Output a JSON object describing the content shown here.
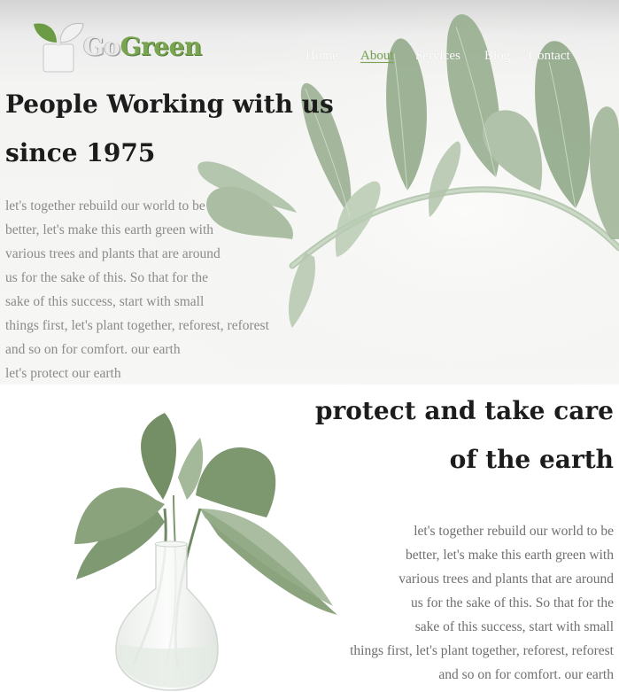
{
  "brand": {
    "name_part1": "Go",
    "name_part2": "Green",
    "accent_color": "#79a551"
  },
  "nav": {
    "items": [
      {
        "label": "Home"
      },
      {
        "label": "About",
        "active": true
      },
      {
        "label": "Services"
      },
      {
        "label": "Blog"
      },
      {
        "label": "Contact"
      }
    ]
  },
  "hero": {
    "title_line1": "People Working with us",
    "title_line2": "since 1975",
    "paragraph_lines": [
      "let's together rebuild our world to be",
      "better, let's make this earth green with",
      "various trees and plants that are around",
      "us for the sake of this. So that for the",
      "sake of this success, start with small",
      "things first, let's plant together, reforest, reforest",
      "and so on for comfort. our earth",
      "let's protect our earth"
    ]
  },
  "section2": {
    "title_line1": "protect and take care",
    "title_line2": "of the earth",
    "paragraph_lines": [
      "let's together rebuild our world to be",
      "better, let's make this earth green with",
      "various trees and plants that are around",
      "us for the sake of this. So that for the",
      "sake of this success, start with small",
      "things first, let's plant together, reforest, reforest",
      "and so on for comfort. our earth"
    ]
  }
}
